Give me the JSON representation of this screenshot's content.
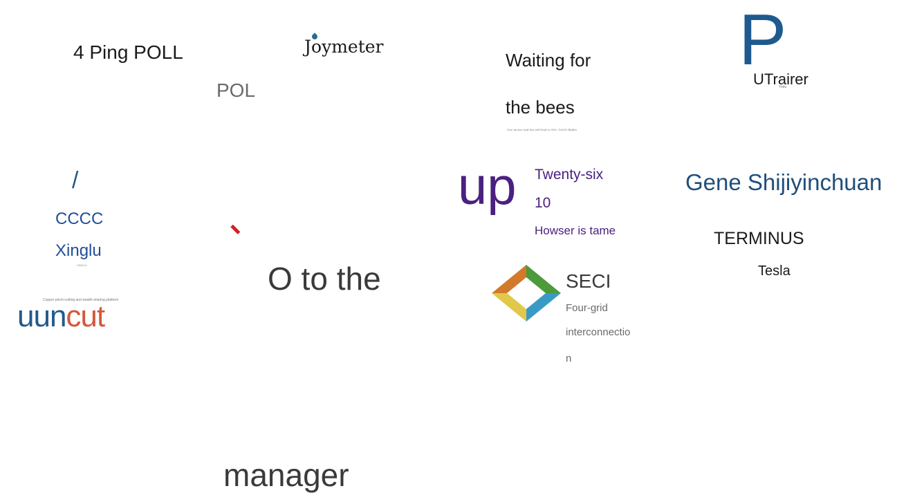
{
  "logos": {
    "ping_poll": "4 Ping POLL",
    "pol": "POL",
    "joymeter": "Joymeter",
    "waiting_line1": "Waiting for",
    "waiting_line2": "the bees",
    "waiting_tagline": "One mouse and fan will lead to 800, 10000 flights",
    "p_letter": "P",
    "utrairer": "UTrairer",
    "yodu": "Yodu",
    "slash": "/",
    "cccc": "CCCC",
    "xinglu": "Xinglu",
    "xinglu_sub": "XINGLU",
    "uun": "uun",
    "cut": "cut",
    "uuncut_tagline": "Copper pinch-cutting and wealth-sharing platform",
    "o_to_the": "O to the",
    "up": "up",
    "twenty_six": "Twenty-six",
    "ten": "10",
    "howser": "Howser is tame",
    "seci": "SECI",
    "four_grid_1": "Four-grid",
    "four_grid_2": "interconnectio",
    "four_grid_3": "n",
    "gene": "Gene Shijiyinchuan",
    "terminus": "TERMINUS",
    "tesla": "Tesla",
    "manager": "manager"
  },
  "colors": {
    "dark": "#1a1a1a",
    "gray": "#6a6a6a",
    "navy_blue": "#1f5a8e",
    "purple": "#4a2080",
    "orange": "#d4583a",
    "red": "#d0202a"
  }
}
